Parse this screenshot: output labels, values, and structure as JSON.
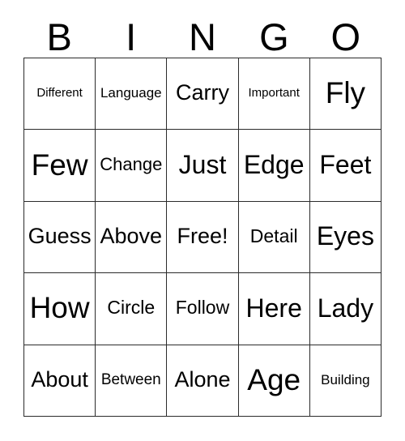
{
  "card": {
    "header_letters": [
      "B",
      "I",
      "N",
      "G",
      "O"
    ],
    "rows": [
      [
        "Different",
        "Language",
        "Carry",
        "Important",
        "Fly"
      ],
      [
        "Few",
        "Change",
        "Just",
        "Edge",
        "Feet"
      ],
      [
        "Guess",
        "Above",
        "Free!",
        "Detail",
        "Eyes"
      ],
      [
        "How",
        "Circle",
        "Follow",
        "Here",
        "Lady"
      ],
      [
        "About",
        "Between",
        "Alone",
        "Age",
        "Building"
      ]
    ],
    "free_space": "Free!",
    "colors": {
      "background": "#ffffff",
      "grid_line": "#2b2b2b",
      "text": "#000000"
    }
  }
}
